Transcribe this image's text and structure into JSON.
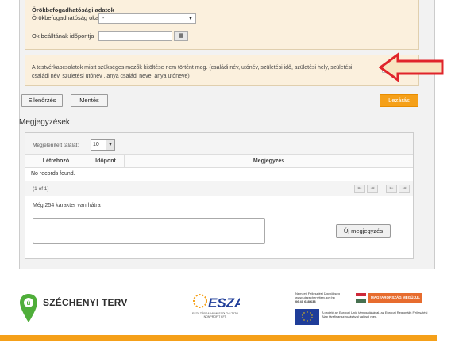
{
  "form": {
    "section_title": "Örökbefogadhatósági adatok",
    "reason_label": "Örökbefogadhatóság oka",
    "reason_value": "-",
    "date_label": "Ok beálltának időpontja",
    "date_value": "",
    "calendar_icon": "calendar-icon"
  },
  "warning": {
    "text": "A testvérkapcsolatok miatt szükséges mezők kitöltése nem történt meg. (családi név, utónév, születési idő, születési hely, születési családi név, születési utónév , anya családi neve, anya utóneve)",
    "checked": false,
    "arrow_color": "#e0242b",
    "arrow_fill": "#f8e4c0"
  },
  "buttons": {
    "check_label": "Ellenőrzés",
    "save_label": "Mentés",
    "close_label": "Lezárás",
    "close_color": "#f5a019"
  },
  "notes": {
    "heading": "Megjegyzések",
    "shown_label": "Megjelenített találat:",
    "shown_count": "10",
    "columns": [
      "Létrehozó",
      "Időpont",
      "Megjegyzés"
    ],
    "no_records": "No records found.",
    "pager_text": "(1 of 1)",
    "pager_buttons": [
      "⇤",
      "⇥",
      "⇤",
      "⇥"
    ],
    "chars_left": "Még 254 karakter van hátra",
    "textarea_value": "",
    "new_note_label": "Új megjegyzés"
  },
  "footer": {
    "szt_text": "SZÉCHENYI TERV",
    "esza_text": "ESZA",
    "esza_sub": "ESZA TÁRSADALMI SZOLGÁLTATÓ NONPROFIT KFT.",
    "ndah_line1": "Nemzeti Fejlesztési Ügynökség",
    "ndah_line2": "www.ujszechenyiterv.gov.hu",
    "ndah_line3": "06 40 638 638",
    "mo_badge": "MAGYARORSZÁG MEGÚJUL",
    "eu_text": "A projekt az Európai Unió támogatásával, az Európai Regionális Fejlesztési Alap társfinanszírozásával valósul meg.",
    "accent": "#f5a019"
  }
}
